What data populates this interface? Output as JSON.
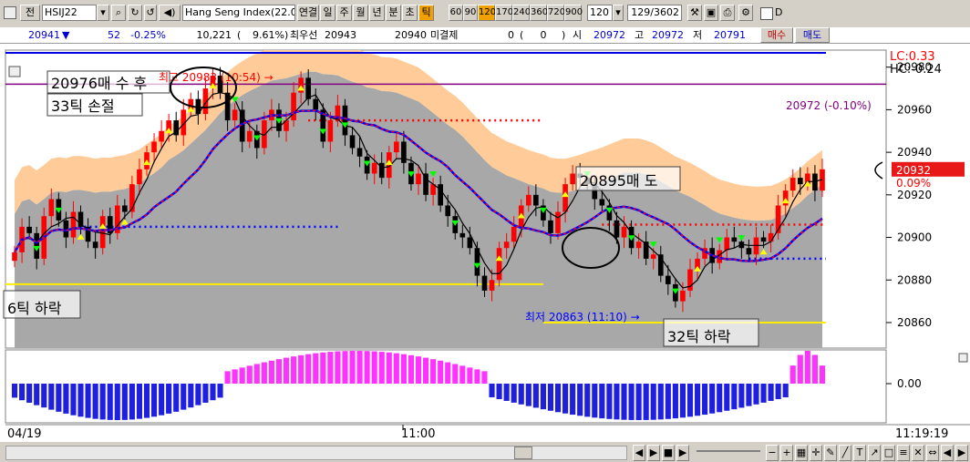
{
  "toolbar": {
    "mode_label": "전",
    "symbol": "HSIJ22",
    "symbol_name": "Hang Seng Index(22.0",
    "period_buttons": [
      "연결",
      "일",
      "주",
      "월",
      "년",
      "분",
      "초",
      "틱"
    ],
    "selected_period": "틱",
    "interval_buttons": [
      "60",
      "90",
      "120",
      "170",
      "240",
      "360",
      "720",
      "900"
    ],
    "selected_interval": "120",
    "interval_value": "120",
    "count_value": "129/3602",
    "checkbox_label": "D"
  },
  "quote": {
    "price": "20941",
    "direction": "▼",
    "change": "52",
    "change_pct": "-0.25%",
    "volume": "10,221",
    "volume_pct": "9.61%",
    "best_ask_label": "최우선",
    "best_ask": "20943",
    "best_bid": "20940",
    "unfilled_label": "미결제",
    "unfilled": "0",
    "unfilled_change": "0",
    "open_label": "시",
    "open": "20972",
    "high_label": "고",
    "high": "20972",
    "low_label": "저",
    "low": "20791",
    "buy_button": "매수",
    "sell_button": "매도"
  },
  "annotations": {
    "buy_note_1": "20976매 수 후",
    "buy_note_2": "33틱 손절",
    "high_marker": "최고 20983 (10:54) →",
    "sell_note": "20895매 도",
    "left_drop": "6틱 하락",
    "low_marker": "최저 20863 (11:10) →",
    "right_drop": "32틱 하락",
    "open_line_label": "20972 (-0.10%)"
  },
  "chart_data": {
    "type": "candlestick",
    "symbol": "HSIJ22",
    "y_ticks": [
      20860,
      20880,
      20900,
      20920,
      20940,
      20960,
      20980
    ],
    "ylim": [
      20848,
      20988
    ],
    "x_tick_labels": [
      "04/19",
      "11:00"
    ],
    "current_time": "11:19:19",
    "current_price_label": "20932",
    "current_change_label": "0.09%",
    "lc_label": "LC:0.33",
    "hc_label": "HC:-0.24",
    "reference_lines": {
      "open": 20972,
      "session_high": 20983,
      "session_low": 20863
    },
    "candles_close": [
      20893,
      20905,
      20902,
      20890,
      20910,
      20918,
      20908,
      20900,
      20912,
      20905,
      20898,
      20895,
      20910,
      20902,
      20915,
      20912,
      20925,
      20932,
      20940,
      20945,
      20950,
      20955,
      20948,
      20960,
      20965,
      20958,
      20970,
      20976,
      20968,
      20955,
      20960,
      20945,
      20950,
      20942,
      20955,
      20960,
      20950,
      20955,
      20968,
      20975,
      20965,
      20960,
      20945,
      20955,
      20962,
      20948,
      20942,
      20938,
      20930,
      20935,
      20928,
      20940,
      20945,
      20935,
      20925,
      20930,
      20920,
      20925,
      20915,
      20910,
      20902,
      20900,
      20895,
      20882,
      20875,
      20880,
      20895,
      20898,
      20905,
      20915,
      20920,
      20915,
      20908,
      20902,
      20912,
      20925,
      20930,
      20928,
      20925,
      20918,
      20915,
      20908,
      20900,
      20905,
      20895,
      20898,
      20890,
      20892,
      20882,
      20878,
      20870,
      20875,
      20885,
      20890,
      20895,
      20888,
      20894,
      20900,
      20898,
      20895,
      20892,
      20900,
      20898,
      20902,
      20915,
      20922,
      20928,
      20925,
      20930,
      20922,
      20932
    ],
    "oscillator": {
      "zero_label": "0.00",
      "segments": [
        {
          "from": 0,
          "to": 28,
          "sign": "negative"
        },
        {
          "from": 29,
          "to": 64,
          "sign": "positive"
        },
        {
          "from": 65,
          "to": 105,
          "sign": "negative"
        },
        {
          "from": 106,
          "to": 110,
          "sign": "positive"
        }
      ]
    }
  }
}
